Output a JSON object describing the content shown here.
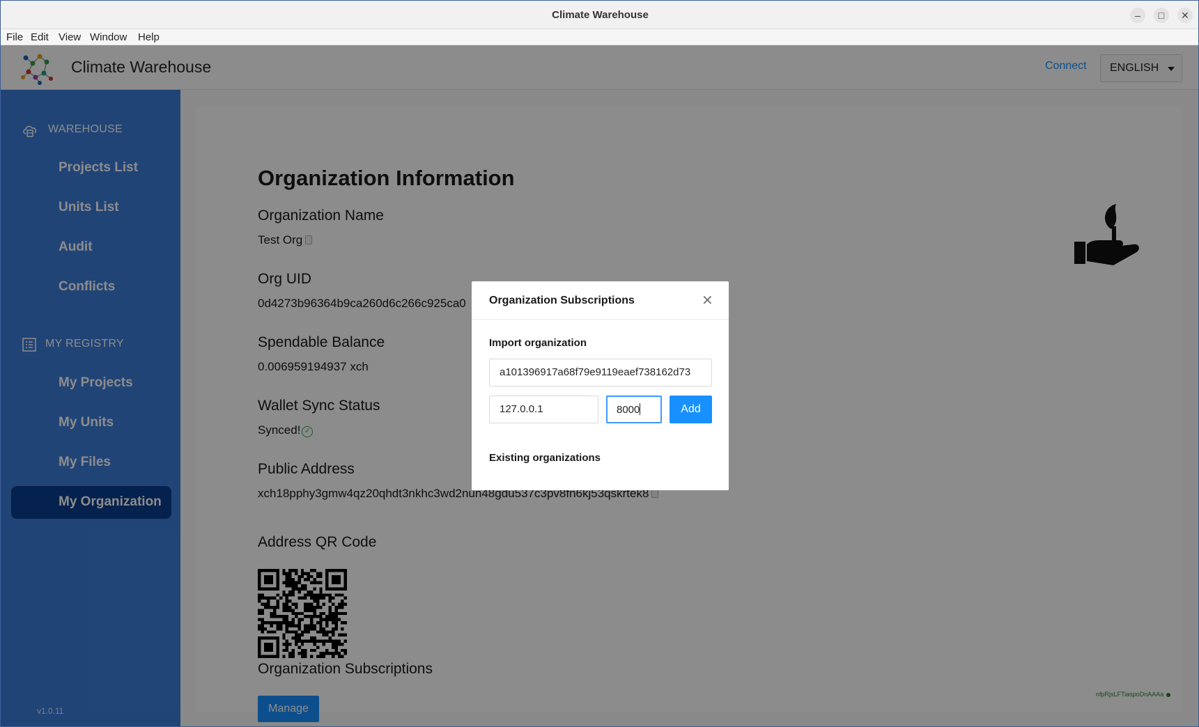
{
  "window": {
    "title": "Climate Warehouse"
  },
  "menu": [
    "File",
    "Edit",
    "View",
    "Window",
    "Help"
  ],
  "header": {
    "brand": "Climate Warehouse",
    "connect": "Connect",
    "language": "ENGLISH"
  },
  "sidebar": {
    "warehouse_heading": "WAREHOUSE",
    "warehouse_items": [
      "Projects List",
      "Units List",
      "Audit",
      "Conflicts"
    ],
    "registry_heading": "MY REGISTRY",
    "registry_items": [
      "My Projects",
      "My Units",
      "My Files",
      "My Organization"
    ],
    "active_item": "My Organization",
    "version": "v1.0.11"
  },
  "main": {
    "title": "Organization Information",
    "org_name_label": "Organization Name",
    "org_name": "Test Org",
    "org_uid_label": "Org UID",
    "org_uid": "0d4273b96364b9ca260d6c266c925ca0",
    "balance_label": "Spendable Balance",
    "balance": "0.006959194937 xch",
    "sync_label": "Wallet Sync Status",
    "sync_status": "Synced!",
    "address_label": "Public Address",
    "address": "xch18pphy3gmw4qz20qhdt3nkhc3wd2nun48gdu537c3pv8fn6kj53qskrtek8",
    "qr_label": "Address QR Code",
    "subscriptions_label": "Organization Subscriptions",
    "manage_button": "Manage",
    "footer_code": "nfpRjsLFTiaspoDnAAAa"
  },
  "modal": {
    "title": "Organization Subscriptions",
    "import_label": "Import organization",
    "org_id_value": "a101396917a68f79e9119eaef738162d73",
    "ip_value": "127.0.0.1",
    "port_value": "8000",
    "add_button": "Add",
    "existing_label": "Existing organizations"
  },
  "colors": {
    "sidebar": "#3c7dd9",
    "active": "#0a3c8c",
    "accent": "#1890ff"
  }
}
